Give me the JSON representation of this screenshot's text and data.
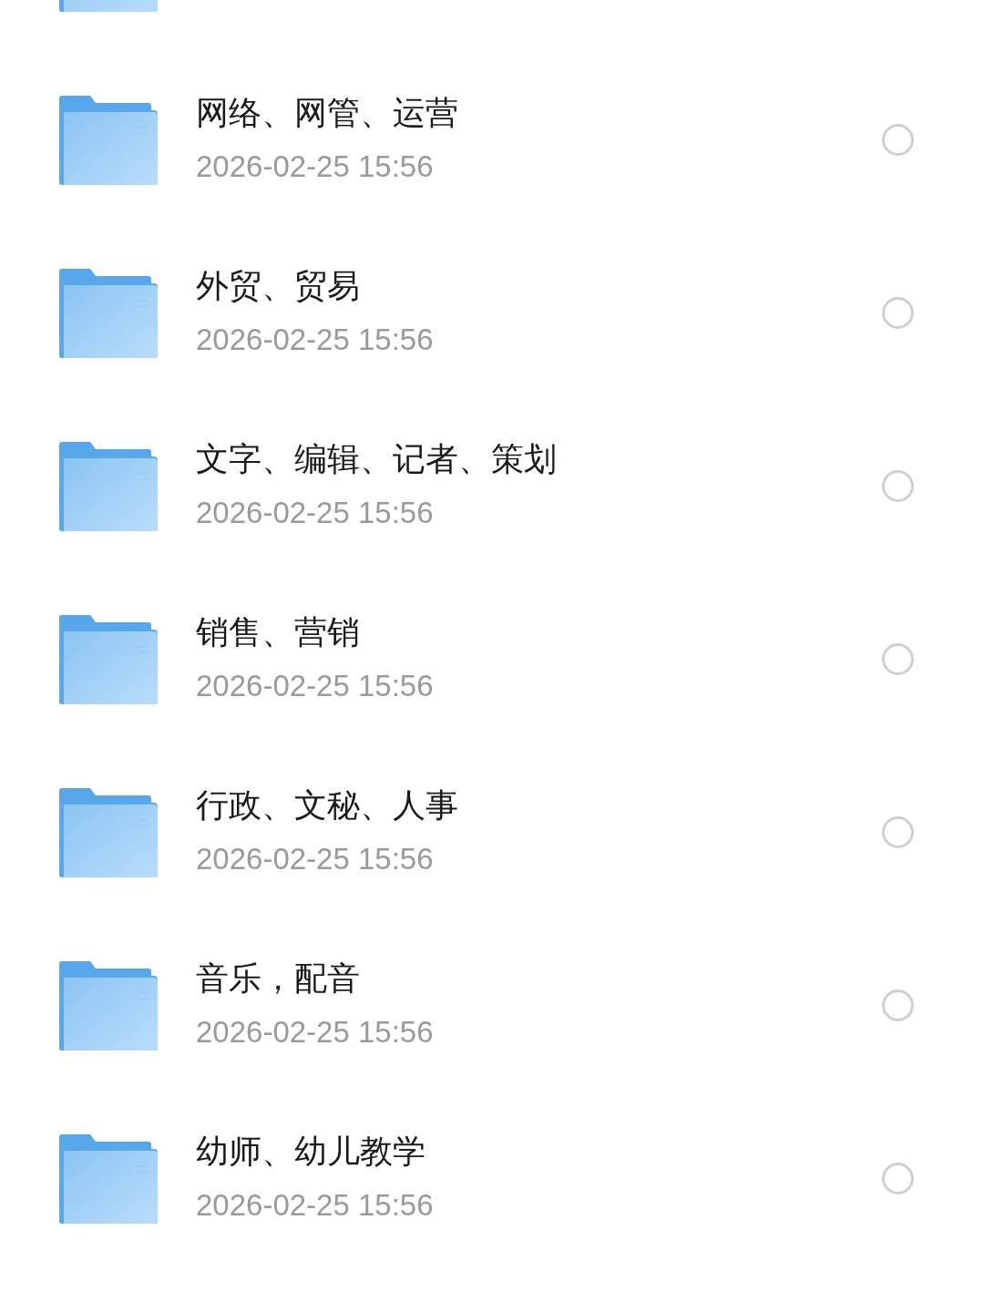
{
  "files": [
    {
      "kind": "partial"
    },
    {
      "kind": "folder",
      "name": "网络、网管、运营",
      "date": "2026-02-25 15:56",
      "selected": false
    },
    {
      "kind": "folder",
      "name": "外贸、贸易",
      "date": "2026-02-25 15:56",
      "selected": false
    },
    {
      "kind": "folder",
      "name": "文字、编辑、记者、策划",
      "date": "2026-02-25 15:56",
      "selected": false
    },
    {
      "kind": "folder",
      "name": "销售、营销",
      "date": "2026-02-25 15:56",
      "selected": false
    },
    {
      "kind": "folder",
      "name": "行政、文秘、人事",
      "date": "2026-02-25 15:56",
      "selected": false
    },
    {
      "kind": "folder",
      "name": "音乐，配音",
      "date": "2026-02-25 15:56",
      "selected": false
    },
    {
      "kind": "folder",
      "name": "幼师、幼儿教学",
      "date": "2026-02-25 15:56",
      "selected": false
    }
  ]
}
